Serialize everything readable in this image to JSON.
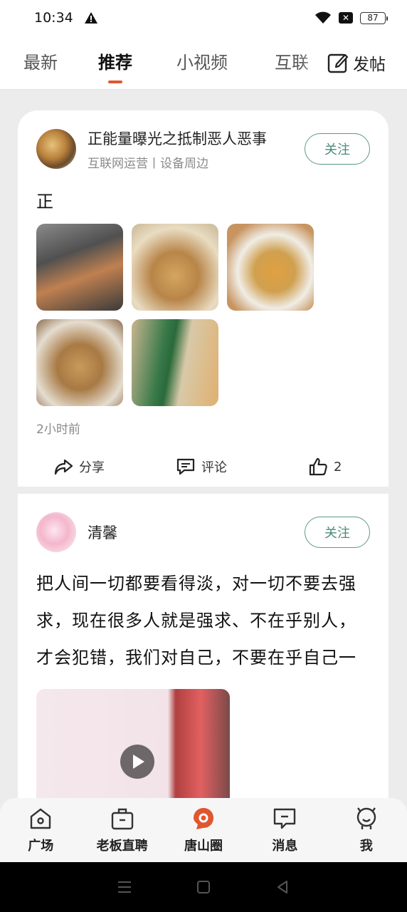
{
  "status_bar": {
    "time": "10:34",
    "battery": "87"
  },
  "tabs": [
    {
      "label": "最新",
      "active": false
    },
    {
      "label": "推荐",
      "active": true
    },
    {
      "label": "小视频",
      "active": false
    },
    {
      "label": "互联",
      "active": false
    }
  ],
  "post_button": {
    "label": "发帖"
  },
  "posts": [
    {
      "author": "正能量曝光之抵制恶人恶事",
      "subtitle": "互联网运营丨设备周边",
      "follow_label": "关注",
      "text": "正",
      "time_ago": "2小时前",
      "share_label": "分享",
      "comment_label": "评论",
      "like_count": "2"
    },
    {
      "author": "清馨",
      "follow_label": "关注",
      "text": "把人间一切都要看得淡，对一切不要去强求，现在很多人就是强求、不在乎别人，才会犯错，我们对自己，不要在乎自己一"
    }
  ],
  "bottom_nav": [
    {
      "label": "广场"
    },
    {
      "label": "老板直聘"
    },
    {
      "label": "唐山圈",
      "active": true
    },
    {
      "label": "消息"
    },
    {
      "label": "我"
    }
  ],
  "colors": {
    "accent": "#e0572f",
    "follow": "#4a8a7a"
  }
}
